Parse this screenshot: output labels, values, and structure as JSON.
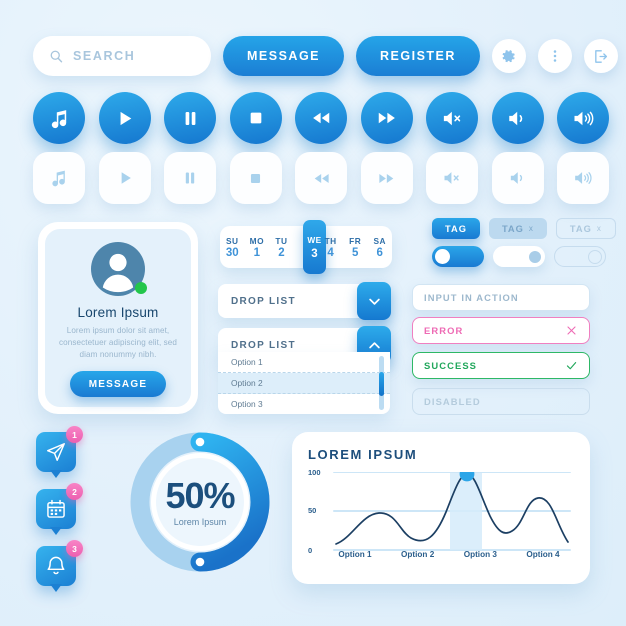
{
  "search": {
    "placeholder": "SEARCH",
    "icon": "search-icon"
  },
  "top_buttons": [
    {
      "label": "MESSAGE",
      "name": "message-button"
    },
    {
      "label": "REGISTER",
      "name": "register-button"
    }
  ],
  "top_icons": [
    {
      "name": "gear-icon",
      "label": "settings"
    },
    {
      "name": "kebab-menu-icon",
      "label": "more options"
    },
    {
      "name": "logout-icon",
      "label": "logout"
    }
  ],
  "media_buttons": [
    {
      "name": "music-note-icon",
      "label": "music"
    },
    {
      "name": "play-icon",
      "label": "play"
    },
    {
      "name": "pause-icon",
      "label": "pause"
    },
    {
      "name": "stop-icon",
      "label": "stop"
    },
    {
      "name": "rewind-icon",
      "label": "rewind"
    },
    {
      "name": "fast-forward-icon",
      "label": "fast forward"
    },
    {
      "name": "volume-mute-icon",
      "label": "mute"
    },
    {
      "name": "volume-low-icon",
      "label": "volume low"
    },
    {
      "name": "volume-high-icon",
      "label": "volume high"
    }
  ],
  "profile": {
    "name": "Lorem Ipsum",
    "description": "Lorem ipsum dolor sit amet, consectetuer adipiscing elit, sed diam nonummy nibh.",
    "button_label": "MESSAGE",
    "status": "online"
  },
  "calendar": {
    "days": [
      {
        "dow": "SU",
        "num": "30",
        "selected": false
      },
      {
        "dow": "MO",
        "num": "1",
        "selected": false
      },
      {
        "dow": "TU",
        "num": "2",
        "selected": false
      },
      {
        "dow": "WE",
        "num": "3",
        "selected": true
      },
      {
        "dow": "TH",
        "num": "4",
        "selected": false
      },
      {
        "dow": "FR",
        "num": "5",
        "selected": false
      },
      {
        "dow": "SA",
        "num": "6",
        "selected": false
      }
    ]
  },
  "tags": [
    {
      "label": "TAG",
      "state": "active",
      "closable": false
    },
    {
      "label": "TAG",
      "state": "soft",
      "closable": true,
      "close": "x"
    },
    {
      "label": "TAG",
      "state": "disabled",
      "closable": true,
      "close": "x"
    }
  ],
  "toggles": [
    {
      "name": "toggle-on",
      "state": "on"
    },
    {
      "name": "toggle-off",
      "state": "off"
    },
    {
      "name": "toggle-disabled",
      "state": "disabled"
    }
  ],
  "dropdowns": {
    "closed": {
      "label": "DROP LIST",
      "arrow": "chevron-down-icon"
    },
    "open": {
      "label": "DROP LIST",
      "arrow": "chevron-up-icon"
    },
    "options": [
      {
        "label": "Option 1",
        "highlighted": false
      },
      {
        "label": "Option 2",
        "highlighted": true
      },
      {
        "label": "Option 3",
        "highlighted": false
      }
    ]
  },
  "inputs": [
    {
      "name": "input-in-action",
      "value": "INPUT IN ACTION",
      "state": "active",
      "icon": "",
      "color": "#9db8cd"
    },
    {
      "name": "input-error",
      "value": "ERROR",
      "state": "error",
      "icon": "close-icon",
      "color": "#ee6ab4"
    },
    {
      "name": "input-success",
      "value": "SUCCESS",
      "state": "success",
      "icon": "check-icon",
      "color": "#21a75b"
    },
    {
      "name": "input-disabled",
      "value": "DISABLED",
      "state": "disabled",
      "icon": "",
      "color": "#b4cbdc"
    }
  ],
  "notifications": [
    {
      "name": "send-icon",
      "badge": "1"
    },
    {
      "name": "calendar-icon",
      "badge": "2"
    },
    {
      "name": "bell-icon",
      "badge": "3"
    }
  ],
  "donut": {
    "percent": "50%",
    "value": 50,
    "caption": "Lorem Ipsum"
  },
  "colors": {
    "background": "#e6f3fc",
    "accent_light": "#2eaaea",
    "accent_dark": "#1577cf",
    "error": "#ee6ab4",
    "success": "#21a75b",
    "badge": "#ed5fb0",
    "online": "#23c64b",
    "text_dark": "#1c4f7d"
  },
  "chart_data": {
    "type": "line",
    "title": "LOREM IPSUM",
    "categories": [
      "Option 1",
      "Option 2",
      "Option 3",
      "Option 4"
    ],
    "values": [
      48,
      17,
      100,
      68
    ],
    "highlight_category": "Option 3",
    "highlight_value": 100,
    "yticks": [
      0,
      50,
      100
    ],
    "ylim": [
      0,
      110
    ],
    "xlabel": "",
    "ylabel": "",
    "grid": true,
    "legend": "none",
    "marker_point": {
      "x": "Option 3",
      "y": 100
    }
  }
}
